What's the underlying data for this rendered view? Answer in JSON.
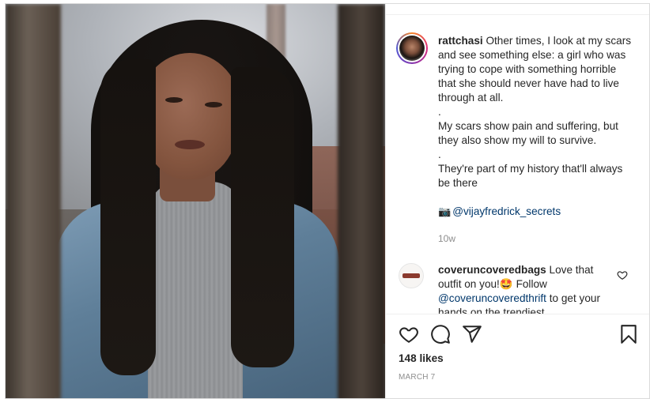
{
  "post": {
    "username": "rattchasi",
    "caption_lines": [
      "Other times, I look at my scars and see something else: a girl who was trying to cope with something horrible that she should never have had to live through at all.",
      ".",
      "My scars show pain and suffering, but they also show my will to survive.",
      ".",
      "They're part of my history that'll always be there"
    ],
    "credit_icon": "📷",
    "credit_handle": "@vijayfredrick_secrets",
    "time_ago": "10w",
    "likes": "148 likes",
    "date": "MARCH 7",
    "photo_icon": "portrait-photo"
  },
  "comment": {
    "username": "coveruncoveredbags",
    "text_before": "Love that outfit on you!",
    "emoji": "🤩",
    "text_mid": "Follow",
    "mention": "@coveruncoveredthrift",
    "text_after": "to get your hands on the trendiest"
  },
  "actions": {
    "like_icon": "heart-icon",
    "comment_icon": "comment-icon",
    "share_icon": "share-icon",
    "save_icon": "bookmark-icon"
  },
  "colors": {
    "link": "#00376b",
    "muted": "#8e8e8e",
    "text": "#262626",
    "border": "#dbdbdb"
  }
}
